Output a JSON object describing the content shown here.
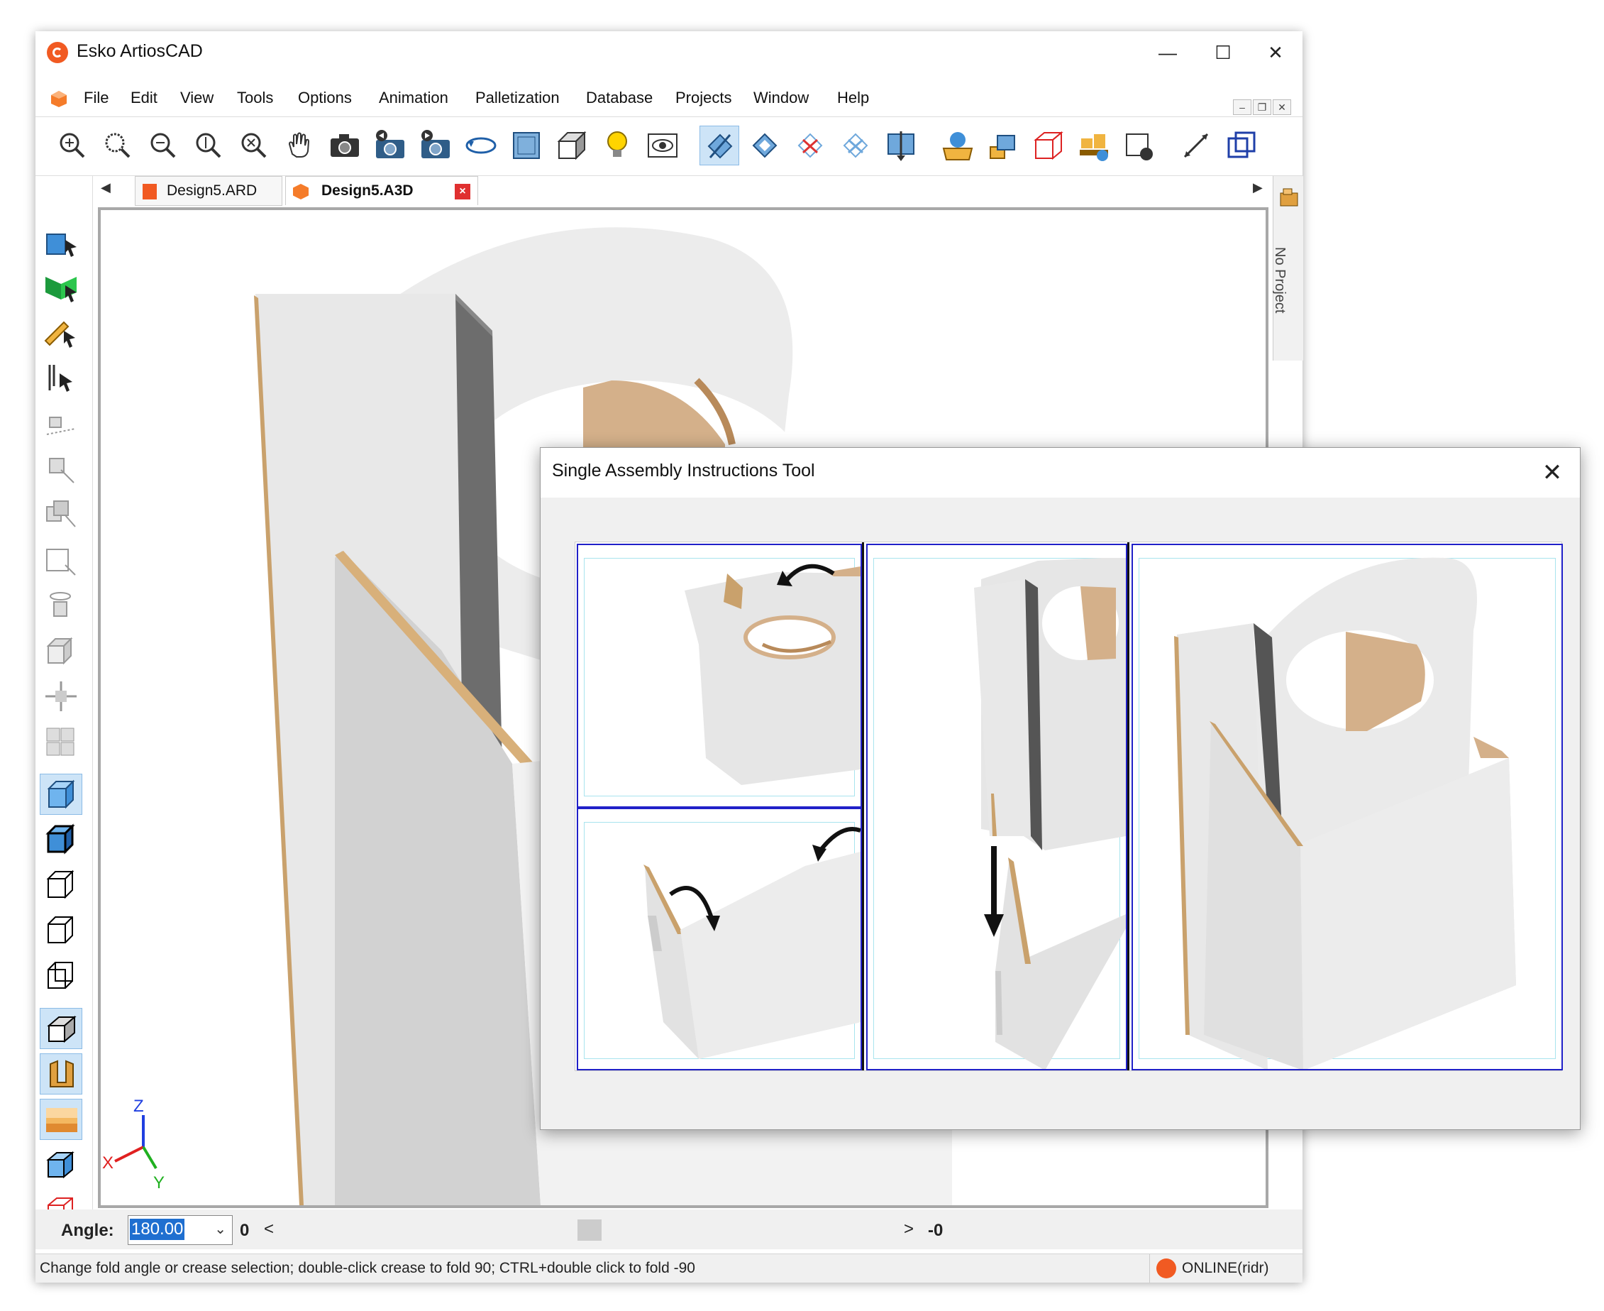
{
  "window": {
    "title": "Esko ArtiosCAD",
    "controls": {
      "minimize": "—",
      "maximize": "☐",
      "close": "✕"
    }
  },
  "menu": {
    "items": [
      "File",
      "Edit",
      "View",
      "Tools",
      "Options",
      "Animation",
      "Palletization",
      "Database",
      "Projects",
      "Window",
      "Help"
    ]
  },
  "mdi": {
    "minimize": "–",
    "restore": "❐",
    "close": "✕"
  },
  "toolbar": {
    "icons": [
      "zoom-in-icon",
      "zoom-window-icon",
      "zoom-out-icon",
      "zoom-extents-icon",
      "zoom-scale-icon",
      "pan-hand-icon",
      "camera-icon",
      "camera-prev-icon",
      "camera-next-icon",
      "rotate-view-icon",
      "flat-view-icon",
      "box-view-icon",
      "light-bulb-icon",
      "eye-view-icon",
      "fold-select-icon",
      "fold-rotate-icon",
      "fold-all-icon",
      "unfold-all-icon",
      "fold-direction-icon",
      "add-solid-icon",
      "assemble-icon",
      "red-box-icon",
      "palletize-icon",
      "movie-icon",
      "resize-arrow-icon",
      "wireframe-cube-icon"
    ]
  },
  "tabs": [
    {
      "label": "Design5.ARD",
      "active": false
    },
    {
      "label": "Design5.A3D",
      "active": true
    }
  ],
  "side_pane": {
    "label": "No Project"
  },
  "axes": {
    "x": "X",
    "y": "Y",
    "z": "Z"
  },
  "angle_bar": {
    "label": "Angle:",
    "value": "180.00",
    "min_label": "0",
    "left_arrow": "<",
    "right_arrow": ">",
    "max_label": "-0"
  },
  "status": {
    "message": "Change fold angle or crease selection; double-click crease to fold 90; CTRL+double click to fold -90",
    "connection": "ONLINE(ridr)"
  },
  "dialog": {
    "title": "Single Assembly Instructions Tool",
    "close": "✕"
  },
  "colors": {
    "accent": "#f15a22",
    "panel_border": "#2020c8",
    "cardboard": "#d4b08a",
    "board": "#e6e6e6"
  }
}
